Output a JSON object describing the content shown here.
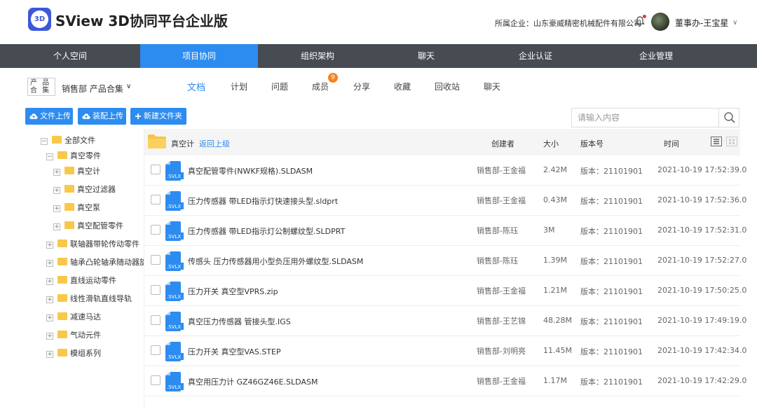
{
  "header": {
    "app_title": "SView 3D协同平台企业版",
    "company": "所属企业：山东豪威精密机械配件有限公司",
    "user": "董事办-王宝星"
  },
  "nav": {
    "items": [
      {
        "label": "个人空间"
      },
      {
        "label": "项目协同"
      },
      {
        "label": "组织架构"
      },
      {
        "label": "聊天"
      },
      {
        "label": "企业认证"
      },
      {
        "label": "企业管理"
      }
    ],
    "active": "项目协同"
  },
  "project": {
    "icon_text": "产 品 合 集",
    "name": "销售部 产品合集",
    "tabs": [
      {
        "label": "文档"
      },
      {
        "label": "计划"
      },
      {
        "label": "问题"
      },
      {
        "label": "成员"
      },
      {
        "label": "分享"
      },
      {
        "label": "收藏"
      },
      {
        "label": "回收站"
      },
      {
        "label": "聊天"
      }
    ],
    "members_badge": "9"
  },
  "toolbar": {
    "upload_file": "文件上传",
    "upload_assembly": "装配上传",
    "new_folder": "新建文件夹",
    "search_placeholder": "请输入内容"
  },
  "tree": {
    "nodes": [
      {
        "label": "全部文件",
        "toggle": "−"
      },
      {
        "label": "真空零件",
        "toggle": "−"
      },
      {
        "label": "真空计",
        "toggle": "+"
      },
      {
        "label": "真空过滤器",
        "toggle": "+"
      },
      {
        "label": "真空泵",
        "toggle": "+"
      },
      {
        "label": "真空配管零件",
        "toggle": "+"
      },
      {
        "label": "联轴器带轮传动零件",
        "toggle": "+"
      },
      {
        "label": "轴承凸轮轴承随动器旋转",
        "toggle": "+"
      },
      {
        "label": "直线运动零件",
        "toggle": "+"
      },
      {
        "label": "线性滑轨直线导轨",
        "toggle": "+"
      },
      {
        "label": "减速马达",
        "toggle": "+"
      },
      {
        "label": "气动元件",
        "toggle": "+"
      },
      {
        "label": "模组系列",
        "toggle": "+"
      }
    ]
  },
  "table": {
    "folder": "真空计",
    "back_link": "返回上级",
    "headers": {
      "creator": "创建者",
      "size": "大小",
      "version": "版本号",
      "time": "时间"
    },
    "icon_label": ".SVLX",
    "rows": [
      {
        "name": "真空配管零件(NWKF规格).SLDASM",
        "creator": "销售部-王金福",
        "size": "2.42M",
        "version": "版本：21101901",
        "time": "2021-10-19 17:52:39.0"
      },
      {
        "name": "压力传感器 带LED指示灯快速接头型.sldprt",
        "creator": "销售部-王金福",
        "size": "0.43M",
        "version": "版本：21101901",
        "time": "2021-10-19 17:52:36.0"
      },
      {
        "name": "压力传感器 带LED指示灯公制螺纹型.SLDPRT",
        "creator": "销售部-陈珏",
        "size": "3M",
        "version": "版本：21101901",
        "time": "2021-10-19 17:52:31.0"
      },
      {
        "name": "传感头 压力传感器用小型负压用外螺纹型.SLDASM",
        "creator": "销售部-陈珏",
        "size": "1.39M",
        "version": "版本：21101901",
        "time": "2021-10-19 17:52:27.0"
      },
      {
        "name": "压力开关 真空型VPRS.zip",
        "creator": "销售部-王金福",
        "size": "1.21M",
        "version": "版本：21101901",
        "time": "2021-10-19 17:50:25.0"
      },
      {
        "name": "真空压力传感器 管接头型.IGS",
        "creator": "销售部-王艺锦",
        "size": "48.28M",
        "version": "版本：21101901",
        "time": "2021-10-19 17:49:19.0"
      },
      {
        "name": "压力开关 真空型VAS.STEP",
        "creator": "销售部-刘明亮",
        "size": "11.45M",
        "version": "版本：21101901",
        "time": "2021-10-19 17:42:34.0"
      },
      {
        "name": "真空用压力计 GZ46GZ46E.SLDASM",
        "creator": "销售部-王金福",
        "size": "1.17M",
        "version": "版本：21101901",
        "time": "2021-10-19 17:42:29.0"
      }
    ]
  }
}
